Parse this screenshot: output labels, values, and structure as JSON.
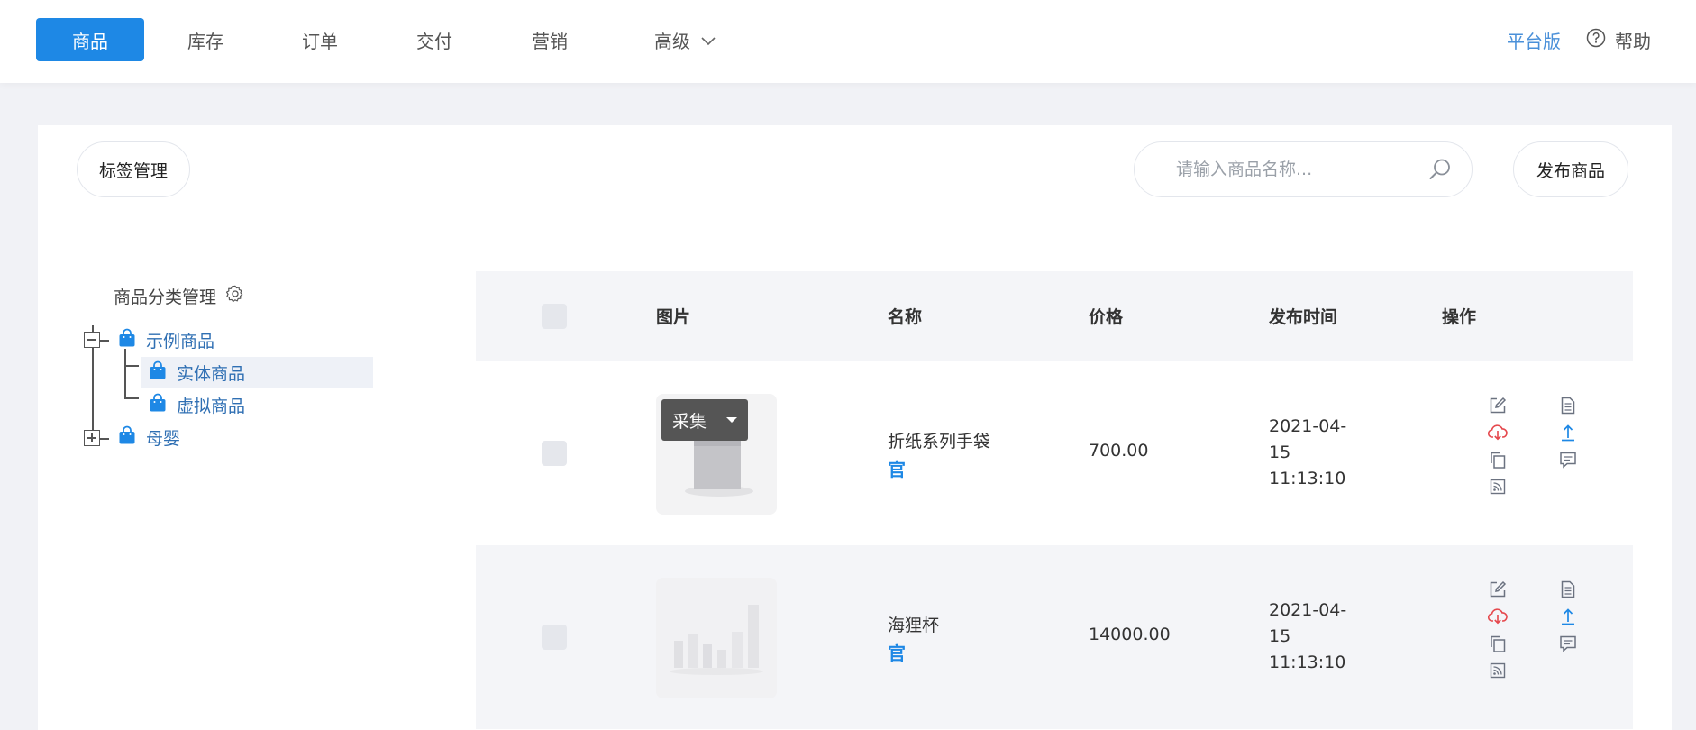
{
  "nav": {
    "tabs": [
      {
        "label": "商品",
        "active": true
      },
      {
        "label": "库存"
      },
      {
        "label": "订单"
      },
      {
        "label": "交付"
      },
      {
        "label": "营销"
      },
      {
        "label": "高级"
      }
    ],
    "platform_link": "平台版",
    "help_label": "帮助"
  },
  "toolbar": {
    "tag_manage_label": "标签管理",
    "search_placeholder": "请输入商品名称...",
    "publish_label": "发布商品"
  },
  "tree": {
    "title": "商品分类管理",
    "nodes": [
      {
        "label": "示例商品",
        "expanded": true
      },
      {
        "label": "实体商品",
        "selected": true
      },
      {
        "label": "虚拟商品"
      },
      {
        "label": "母婴",
        "expanded": false
      }
    ]
  },
  "table": {
    "headers": {
      "image": "图片",
      "name": "名称",
      "price": "价格",
      "time": "发布时间",
      "ops": "操作"
    },
    "rows": [
      {
        "name": "折纸系列手袋",
        "badge": "官",
        "price": "700.00",
        "time_line1": "2021-04-",
        "time_line2": "15",
        "time_line3": "11:13:10",
        "collect_label": "采集"
      },
      {
        "name": "海狸杯",
        "badge": "官",
        "price": "14000.00",
        "time_line1": "2021-04-",
        "time_line2": "15",
        "time_line3": "11:13:10"
      }
    ]
  },
  "colors": {
    "accent": "#1e88e5",
    "link": "#2f6fb3",
    "danger": "#e5484d"
  },
  "icons": [
    "chevron-down-icon",
    "help-circle-icon",
    "search-icon",
    "gear-icon",
    "shopping-bag-icon",
    "edit-icon",
    "cloud-download-icon",
    "copy-icon",
    "rss-icon",
    "document-icon",
    "upload-icon",
    "comment-icon"
  ]
}
